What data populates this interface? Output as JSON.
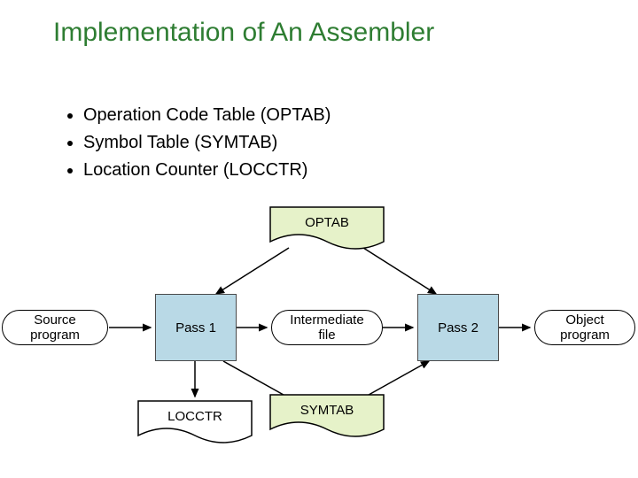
{
  "title": "Implementation of An Assembler",
  "bullets": [
    "Operation Code Table (OPTAB)",
    "Symbol Table (SYMTAB)",
    "Location Counter (LOCCTR)"
  ],
  "diagram": {
    "optab": "OPTAB",
    "source": "Source program",
    "pass1": "Pass 1",
    "intermediate": "Intermediate file",
    "pass2": "Pass 2",
    "object": "Object program",
    "locctr": "LOCCTR",
    "symtab": "SYMTAB"
  }
}
